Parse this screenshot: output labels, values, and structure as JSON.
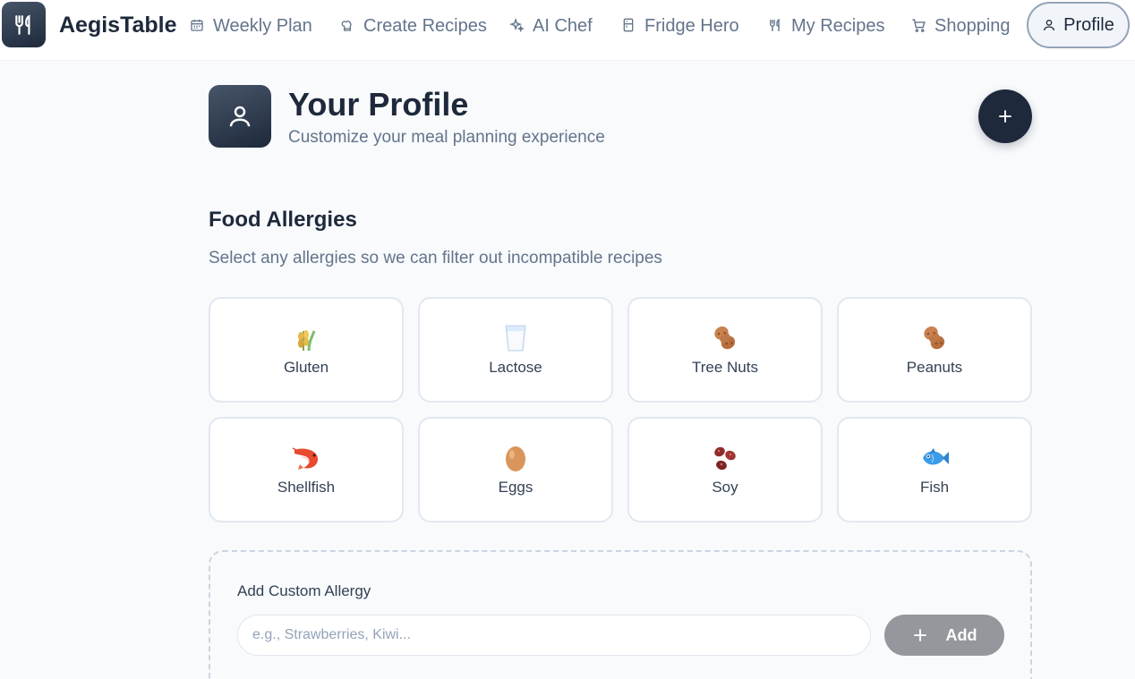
{
  "app": {
    "brand": "AegisTable"
  },
  "nav": {
    "items": [
      {
        "label": "Weekly Plan",
        "icon": "calendar-icon"
      },
      {
        "label": "Create Recipes",
        "icon": "chef-hat-icon"
      },
      {
        "label": "AI Chef",
        "icon": "sparkles-icon"
      },
      {
        "label": "Fridge Hero",
        "icon": "fridge-icon"
      },
      {
        "label": "My Recipes",
        "icon": "utensils-icon"
      },
      {
        "label": "Shopping",
        "icon": "cart-icon"
      }
    ],
    "active": {
      "label": "Profile",
      "icon": "user-icon"
    }
  },
  "header": {
    "title": "Your Profile",
    "subtitle": "Customize your meal planning experience"
  },
  "allergies": {
    "title": "Food Allergies",
    "subtitle": "Select any allergies so we can filter out incompatible recipes",
    "items": [
      {
        "label": "Gluten",
        "icon": "wheat-icon"
      },
      {
        "label": "Lactose",
        "icon": "milk-glass-icon"
      },
      {
        "label": "Tree Nuts",
        "icon": "nut-icon"
      },
      {
        "label": "Peanuts",
        "icon": "peanut-icon"
      },
      {
        "label": "Shellfish",
        "icon": "shrimp-icon"
      },
      {
        "label": "Eggs",
        "icon": "egg-icon"
      },
      {
        "label": "Soy",
        "icon": "beans-icon"
      },
      {
        "label": "Fish",
        "icon": "fish-icon"
      }
    ]
  },
  "custom_allergy": {
    "label": "Add Custom Allergy",
    "placeholder": "e.g., Strawberries, Kiwi...",
    "value": "",
    "button_label": "Add"
  },
  "colors": {
    "primary": "#1e293b",
    "muted_text": "#64748b",
    "card_border": "#e2e8f0",
    "disabled_button": "#94979c"
  }
}
